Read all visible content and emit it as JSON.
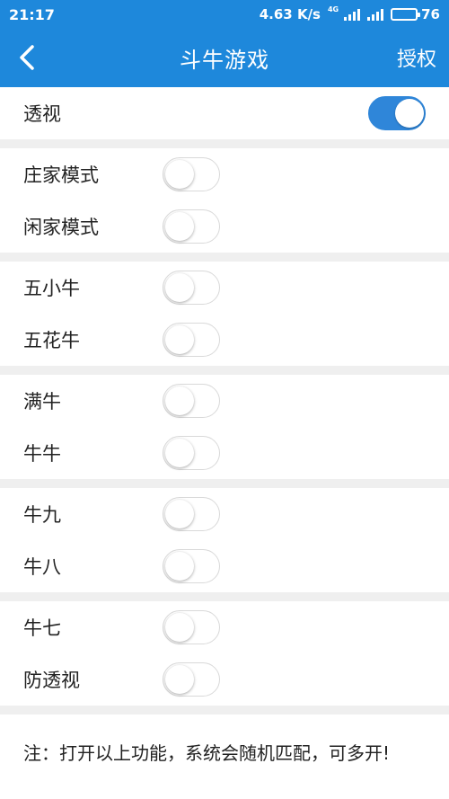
{
  "status_bar": {
    "time": "21:17",
    "net_speed": "4.63 K/s",
    "network_tag": "4G",
    "battery": "76",
    "battery_level_percent": 76
  },
  "nav": {
    "title": "斗牛游戏",
    "right_action": "授权"
  },
  "rows": [
    {
      "label": "透视",
      "on": true
    },
    {
      "label": "庄家模式",
      "on": false
    },
    {
      "label": "闲家模式",
      "on": false
    },
    {
      "label": "五小牛",
      "on": false
    },
    {
      "label": "五花牛",
      "on": false
    },
    {
      "label": "满牛",
      "on": false
    },
    {
      "label": "牛牛",
      "on": false
    },
    {
      "label": "牛九",
      "on": false
    },
    {
      "label": "牛八",
      "on": false
    },
    {
      "label": "牛七",
      "on": false
    },
    {
      "label": "防透视",
      "on": false
    }
  ],
  "note": "注：打开以上功能，系统会随机匹配，可多开!",
  "colors": {
    "primary": "#1e88db",
    "toggle_on": "#2f86d9",
    "background": "#efefef"
  }
}
